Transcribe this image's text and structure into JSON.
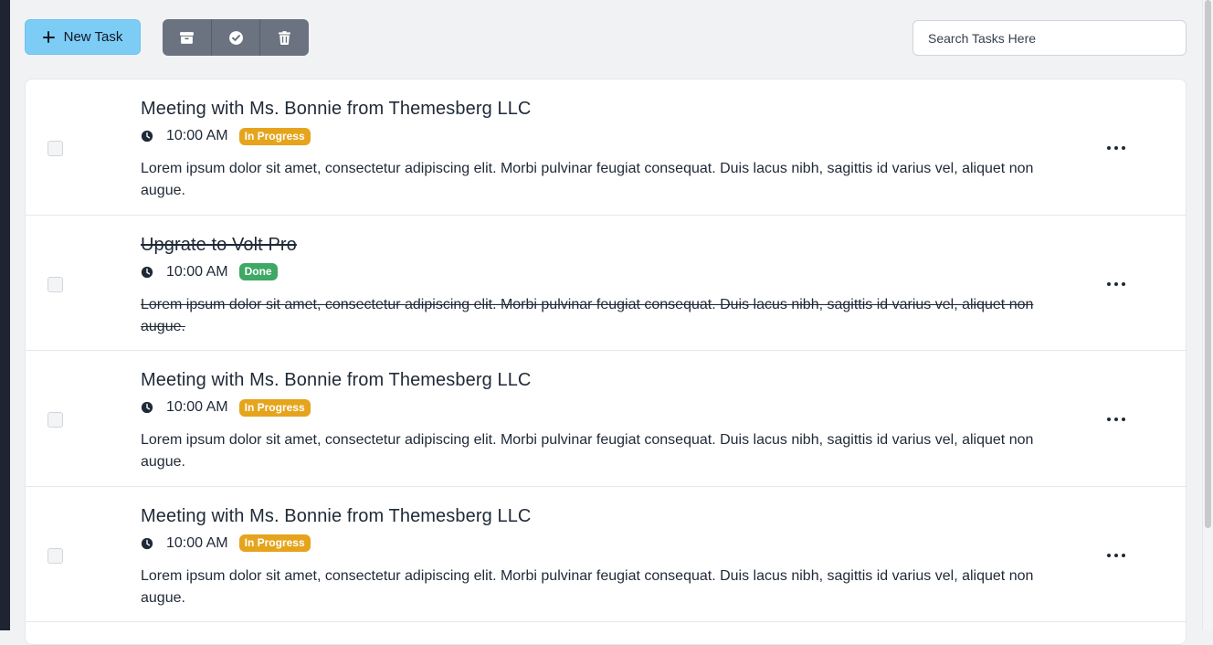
{
  "toolbar": {
    "new_task_label": "New Task",
    "group_buttons": [
      {
        "icon": "archive-icon"
      },
      {
        "icon": "check-circle-icon"
      },
      {
        "icon": "trash-icon"
      }
    ]
  },
  "search": {
    "placeholder": "Search Tasks Here",
    "value": ""
  },
  "tasks": [
    {
      "title": "Meeting with Ms. Bonnie from Themesberg LLC",
      "time": "10:00 AM",
      "status": "In Progress",
      "done": false,
      "description": "Lorem ipsum dolor sit amet, consectetur adipiscing elit. Morbi pulvinar feugiat consequat. Duis lacus nibh, sagittis id varius vel, aliquet non augue."
    },
    {
      "title": "Upgrate to Volt Pro",
      "time": "10:00 AM",
      "status": "Done",
      "done": true,
      "description": "Lorem ipsum dolor sit amet, consectetur adipiscing elit. Morbi pulvinar feugiat consequat. Duis lacus nibh, sagittis id varius vel, aliquet non augue."
    },
    {
      "title": "Meeting with Ms. Bonnie from Themesberg LLC",
      "time": "10:00 AM",
      "status": "In Progress",
      "done": false,
      "description": "Lorem ipsum dolor sit amet, consectetur adipiscing elit. Morbi pulvinar feugiat consequat. Duis lacus nibh, sagittis id varius vel, aliquet non augue."
    },
    {
      "title": "Meeting with Ms. Bonnie from Themesberg LLC",
      "time": "10:00 AM",
      "status": "In Progress",
      "done": false,
      "description": "Lorem ipsum dolor sit amet, consectetur adipiscing elit. Morbi pulvinar feugiat consequat. Duis lacus nibh, sagittis id varius vel, aliquet non augue."
    }
  ],
  "colors": {
    "primary_button": "#7dccf6",
    "group_button": "#6b7280",
    "in_progress": "#e5a41c",
    "done": "#3ea864"
  }
}
